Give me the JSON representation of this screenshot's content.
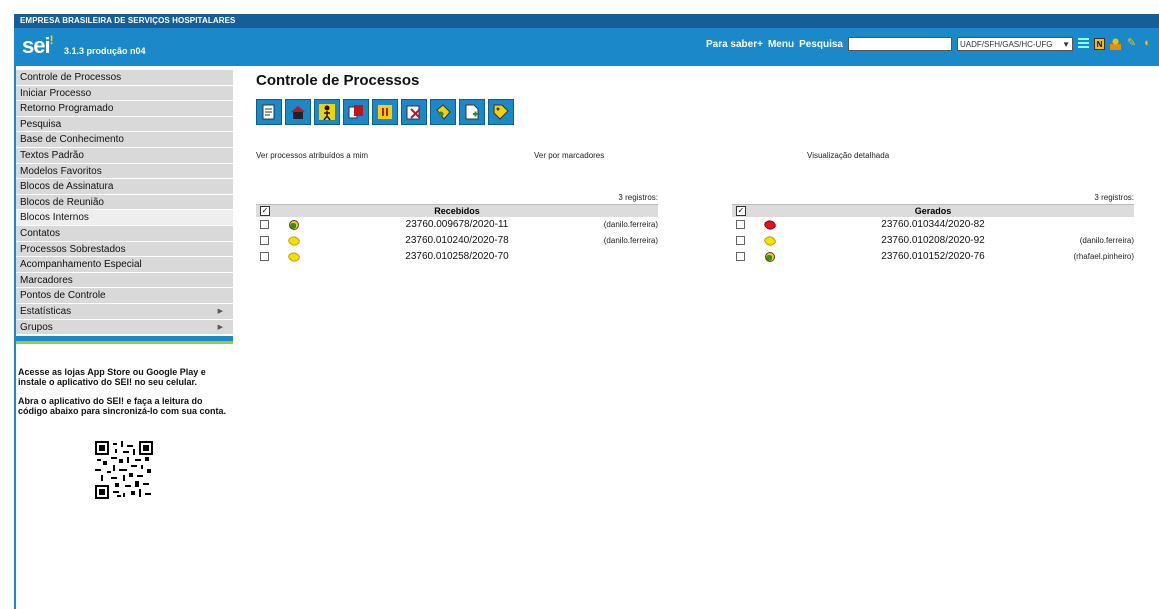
{
  "header": {
    "org": "EMPRESA BRASILEIRA DE SERVIÇOS HOSPITALARES",
    "logo": "sei",
    "logo_mark": "!",
    "version": "3.1.3 produção n04",
    "links": {
      "para_saber": "Para saber+",
      "menu": "Menu",
      "pesquisa": "Pesquisa"
    },
    "search_value": "",
    "unit_selected": "UADF/SFH/GAS/HC-UFG",
    "icons": [
      "grid-icon",
      "notification-n-icon",
      "user-icon",
      "tools-icon",
      "exit-icon"
    ]
  },
  "sidebar": {
    "items": [
      {
        "label": "Controle de Processos",
        "submenu": false
      },
      {
        "label": "Iniciar Processo",
        "submenu": false
      },
      {
        "label": "Retorno Programado",
        "submenu": false
      },
      {
        "label": "Pesquisa",
        "submenu": false
      },
      {
        "label": "Base de Conhecimento",
        "submenu": false
      },
      {
        "label": "Textos Padrão",
        "submenu": false
      },
      {
        "label": "Modelos Favoritos",
        "submenu": false
      },
      {
        "label": "Blocos de Assinatura",
        "submenu": false
      },
      {
        "label": "Blocos de Reunião",
        "submenu": false
      },
      {
        "label": "Blocos Internos",
        "submenu": false
      },
      {
        "label": "Contatos",
        "submenu": false
      },
      {
        "label": "Processos Sobrestados",
        "submenu": false
      },
      {
        "label": "Acompanhamento Especial",
        "submenu": false
      },
      {
        "label": "Marcadores",
        "submenu": false
      },
      {
        "label": "Pontos de Controle",
        "submenu": false
      },
      {
        "label": "Estatísticas",
        "submenu": true
      },
      {
        "label": "Grupos",
        "submenu": true
      }
    ],
    "promo_1": "Acesse as lojas App Store ou Google Play e instale o aplicativo do SEI! no seu celular.",
    "promo_2": "Abra o aplicativo do SEI! e faça a leitura do código abaixo para sincronizá-lo com sua conta."
  },
  "main": {
    "title": "Controle de Processos",
    "toolbar": [
      "send-process-icon",
      "update-tramitation-icon",
      "assign-process-icon",
      "sobrestar-icon",
      "conclude-process-icon",
      "remove-process-icon",
      "tag-marker-icon",
      "new-document-icon",
      "add-marker-icon"
    ],
    "options": {
      "atribuidos": "Ver processos atribuídos a mim",
      "marcadores": "Ver por marcadores",
      "detalhada": "Visualização detalhada"
    },
    "recebidos": {
      "count": "3 registros:",
      "header": "Recebidos",
      "rows": [
        {
          "tag": "green",
          "number": "23760.009678/2020-11",
          "user": "(danilo.ferreira)"
        },
        {
          "tag": "yellow",
          "number": "23760.010240/2020-78",
          "user": "(danilo.ferreira)"
        },
        {
          "tag": "yellow",
          "number": "23760.010258/2020-70",
          "user": ""
        }
      ]
    },
    "gerados": {
      "count": "3 registros:",
      "header": "Gerados",
      "rows": [
        {
          "tag": "red",
          "number": "23760.010344/2020-82",
          "user": ""
        },
        {
          "tag": "yellow",
          "number": "23760.010208/2020-92",
          "user": "(danilo.ferreira)"
        },
        {
          "tag": "green",
          "number": "23760.010152/2020-76",
          "user": "(rhafael.pinheiro)"
        }
      ]
    }
  }
}
